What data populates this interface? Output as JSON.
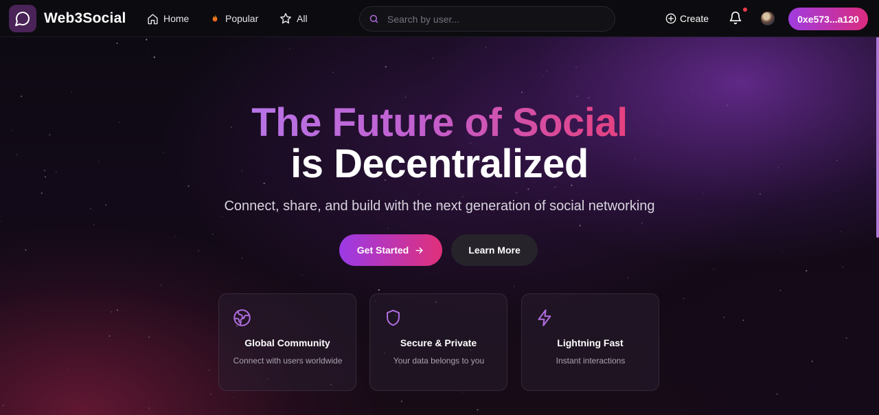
{
  "nav": {
    "brand": "Web3Social",
    "links": [
      {
        "label": "Home",
        "icon": "home-icon"
      },
      {
        "label": "Popular",
        "icon": "flame-icon"
      },
      {
        "label": "All",
        "icon": "star-icon"
      }
    ],
    "search_placeholder": "Search by user...",
    "create_label": "Create",
    "wallet_address": "0xe573...a120",
    "notification_dot": true
  },
  "hero": {
    "title_gradient": "The Future of Social",
    "title_plain": "is Decentralized",
    "subtitle": "Connect, share, and build with the next generation of social networking",
    "primary_button": "Get Started",
    "secondary_button": "Learn More"
  },
  "features": [
    {
      "title": "Global Community",
      "description": "Connect with users worldwide",
      "icon": "globe-icon"
    },
    {
      "title": "Secure & Private",
      "description": "Your data belongs to you",
      "icon": "shield-icon"
    },
    {
      "title": "Lightning Fast",
      "description": "Instant interactions",
      "icon": "lightning-icon"
    }
  ],
  "colors": {
    "accent_purple": "#a03ce0",
    "accent_pink": "#db2b7e",
    "icon_purple": "#b06ee0"
  }
}
